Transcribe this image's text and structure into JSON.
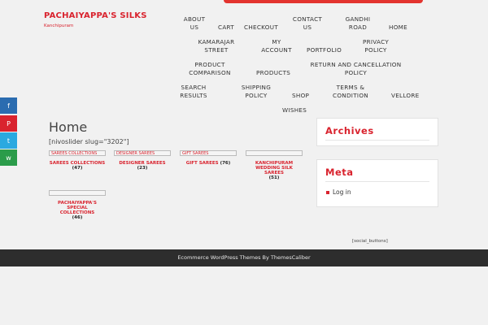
{
  "site": {
    "title": "PACHAIYAPPA'S SILKS",
    "tagline": "Kanchipuram"
  },
  "nav": {
    "about": "ABOUT US",
    "cart": "CART",
    "checkout": "CHECKOUT",
    "contact": "CONTACT US",
    "gandhi": "GANDHI ROAD",
    "home": "HOME",
    "kamarajar": "KAMARAJAR STREET",
    "myaccount": "MY ACCOUNT",
    "portfolio": "PORTFOLIO",
    "privacy": "PRIVACY POLICY",
    "comparison": "PRODUCT COMPARISON",
    "products": "PRODUCTS",
    "refund": "RETURN AND CANCELLATION POLICY",
    "search": "SEARCH RESULTS",
    "shipping": "SHIPPING POLICY",
    "shop": "SHOP",
    "terms": "TERMS & CONDITION",
    "vellore": "VELLORE",
    "wishes": "WISHES"
  },
  "social": {
    "facebook": "f",
    "pinterest": "P",
    "twitter": "t",
    "whatsapp": "w"
  },
  "page": {
    "title": "Home",
    "shortcode": "[nivoslider slug=\"3202\"]"
  },
  "categories": [
    {
      "image_alt": "SAREES COLLECTIONS",
      "name": "SAREES COLLECTIONS",
      "count": "(47)"
    },
    {
      "image_alt": "DESIGNER SAREES",
      "name": "DESIGNER SAREES",
      "count": "(23)"
    },
    {
      "image_alt": "GIFT SAREES",
      "name": "GIFT SAREES",
      "count": "(76)"
    },
    {
      "image_alt": "",
      "name": "KANCHIPURAM WEDDING SILK SAREES",
      "count": "(51)"
    },
    {
      "image_alt": "",
      "name": "PACHAIYAPPA'S SPECIAL COLLECTIONS",
      "count": "(46)"
    }
  ],
  "sidebar": {
    "archives_title": "Archives",
    "meta_title": "Meta",
    "meta_login": "Log in"
  },
  "social_buttons": "[social_buttons]",
  "footer": {
    "text": "Ecommerce WordPress Themes By ThemesCaliber"
  },
  "colors": {
    "accent": "#d9232e",
    "footer_bg": "#2d2d2d",
    "facebook": "#2b6cb0",
    "twitter": "#2aa9e0",
    "whatsapp": "#2b9c4a"
  }
}
